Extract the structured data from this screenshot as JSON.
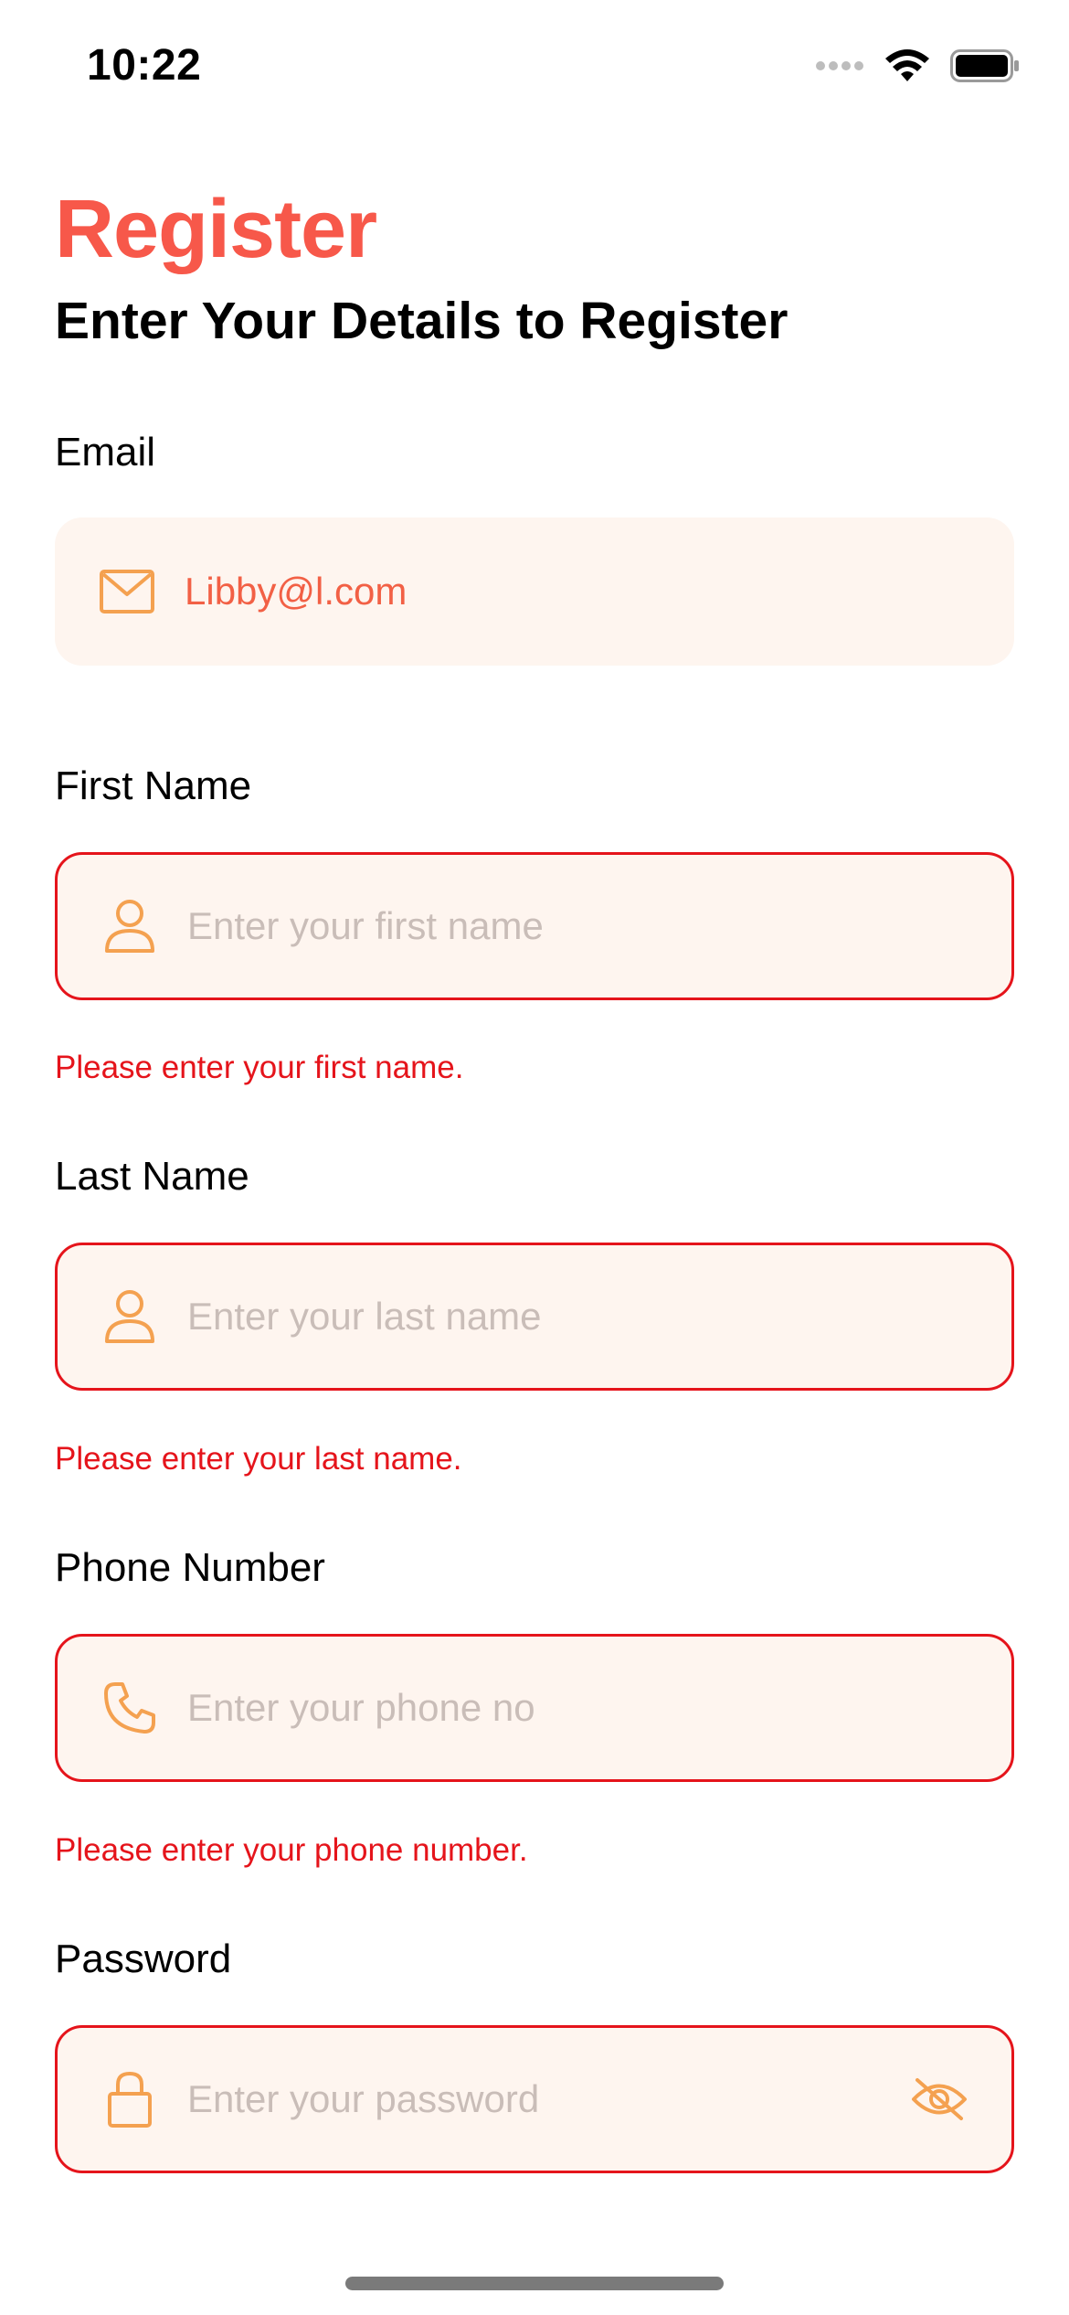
{
  "status_bar": {
    "time": "10:22",
    "icons": [
      "signal-icon",
      "wifi-icon",
      "battery-icon"
    ]
  },
  "header": {
    "title": "Register",
    "subtitle": "Enter Your Details to Register"
  },
  "form": {
    "email": {
      "label": "Email",
      "value": "Libby@l.com",
      "icon": "mail-icon"
    },
    "first_name": {
      "label": "First Name",
      "placeholder": "Enter your first name",
      "icon": "user-icon",
      "error": "Please enter your first name."
    },
    "last_name": {
      "label": "Last Name",
      "placeholder": "Enter your last name",
      "icon": "user-icon",
      "error": "Please enter your last name."
    },
    "phone": {
      "label": "Phone Number",
      "placeholder": "Enter your phone no",
      "icon": "phone-icon",
      "error": "Please enter your phone number."
    },
    "password": {
      "label": "Password",
      "placeholder": "Enter your password",
      "icon": "lock-icon",
      "toggle_icon": "eye-off-icon"
    }
  },
  "colors": {
    "accent": "#F7584A",
    "field_bg": "#FEF5EF",
    "error": "#E5141B",
    "icon": "#F4A150",
    "placeholder": "#C9BDB8"
  }
}
